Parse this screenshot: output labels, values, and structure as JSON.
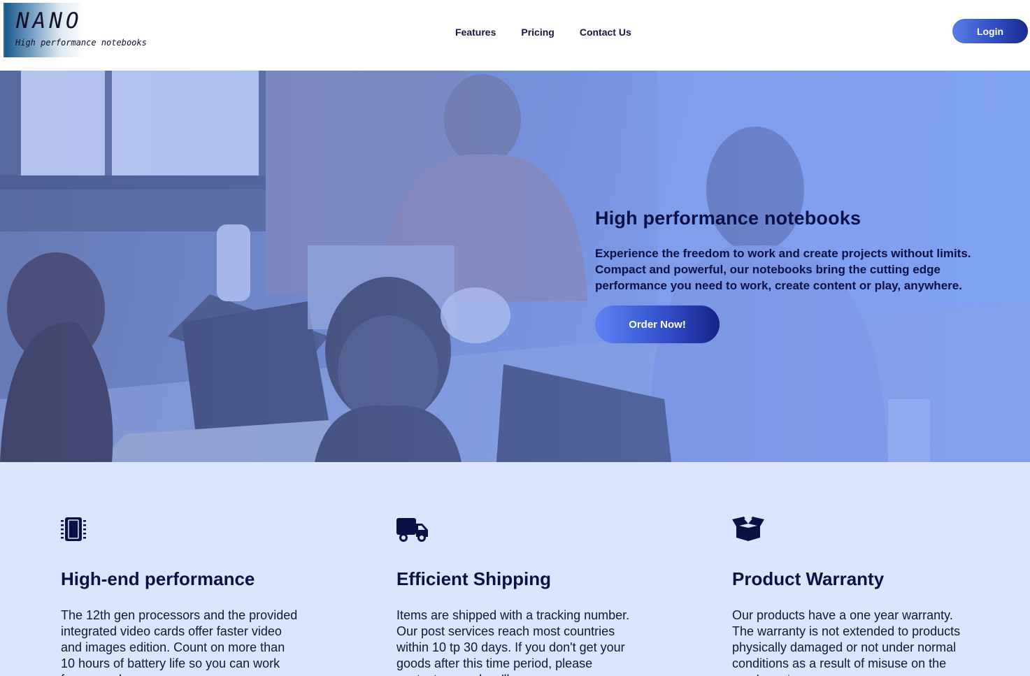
{
  "header": {
    "logo": {
      "title": "NANO",
      "subtitle": "High performance notebooks"
    },
    "nav": [
      {
        "label": "Features"
      },
      {
        "label": "Pricing"
      },
      {
        "label": "Contact Us"
      }
    ],
    "login_label": "Login"
  },
  "hero": {
    "title": "High performance notebooks",
    "text": "Experience the freedom to work and create projects without limits. Compact and powerful, our notebooks bring the cutting edge performance you need to work, create content or play, anywhere.",
    "cta_label": "Order Now!"
  },
  "features": [
    {
      "icon": "chip-icon",
      "title": "High-end performance",
      "text": "The 12th gen processors and the provided integrated video cards offer faster video and images edition. Count on more than 10 hours of battery life so you can work from anywhere."
    },
    {
      "icon": "truck-icon",
      "title": "Efficient Shipping",
      "text": "Items are shipped with a tracking number. Our post services reach most countries within 10 tp 30 days. If you don't get your goods after this time period, please contact us, and we'll"
    },
    {
      "icon": "box-icon",
      "title": "Product Warranty",
      "text": "Our products have a one year warranty. The warranty is not extended to products physically damaged or not under normal conditions as a result of misuse on the user's part."
    }
  ],
  "colors": {
    "accent": "#2f4fc4",
    "dark_text": "#0c1145",
    "features_bg": "#dbe5fd"
  }
}
